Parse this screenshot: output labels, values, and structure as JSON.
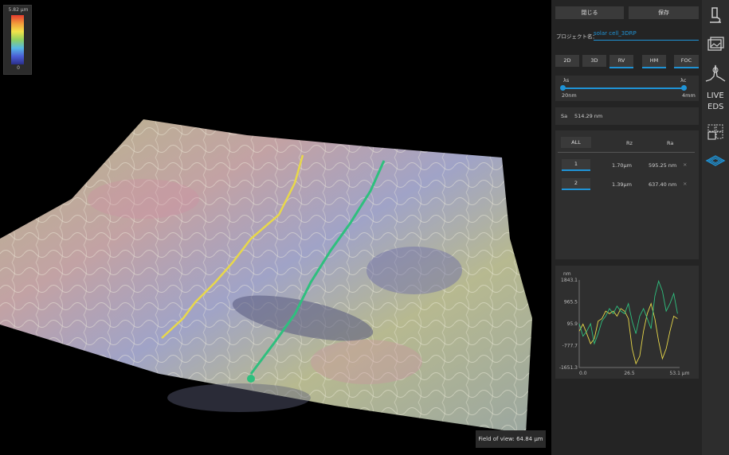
{
  "colorbar": {
    "max_label": "5.82 µm",
    "min_label": "0"
  },
  "field_of_view": "Field of view: 64.84 µm",
  "toolbar": {
    "close_label": "閉じる",
    "save_label": "保存"
  },
  "project": {
    "label": "プロジェクト名：",
    "value": "solar cell_3DRP"
  },
  "view_tabs": [
    "2D",
    "3D",
    "RV",
    "HM",
    "FOC"
  ],
  "filter": {
    "left_label": "λs",
    "right_label": "λc",
    "left_value": "20nm",
    "right_value": "4mm"
  },
  "sa": {
    "label": "Sa",
    "value": "514.29 nm"
  },
  "roughness_table": {
    "all_label": "ALL",
    "headers": [
      "Rz",
      "Ra"
    ],
    "rows": [
      {
        "id": "1",
        "rz": "1.70µm",
        "ra": "595.25 nm",
        "remove": "×"
      },
      {
        "id": "2",
        "rz": "1.39µm",
        "ra": "637.40 nm",
        "remove": "×"
      }
    ]
  },
  "chart_data": {
    "type": "line",
    "y_unit_label": "nm",
    "y_ticks": [
      "1843.1",
      "965.5",
      "95.9",
      "-777.7",
      "-1651.3"
    ],
    "x_ticks": [
      "0.0",
      "26.5",
      "53.1 µm"
    ],
    "xlim": [
      0,
      53.1
    ],
    "ylim": [
      -1651.3,
      1843.1
    ],
    "series": [
      {
        "color": "#e8d84a",
        "x": [
          0,
          2,
          4,
          6,
          8,
          10,
          12,
          14,
          16,
          18,
          20,
          22,
          24,
          26,
          28,
          30,
          32,
          34,
          36,
          38,
          40,
          42,
          44,
          46,
          48,
          50,
          52
        ],
        "values": [
          -200,
          80,
          -300,
          -700,
          -500,
          200,
          300,
          600,
          500,
          600,
          400,
          700,
          600,
          300,
          -900,
          -1500,
          -1200,
          -200,
          500,
          900,
          300,
          -600,
          -1300,
          -900,
          -200,
          400,
          300
        ]
      },
      {
        "color": "#2fbf7e",
        "x": [
          0,
          2,
          4,
          6,
          8,
          10,
          12,
          14,
          16,
          18,
          20,
          22,
          24,
          26,
          28,
          30,
          32,
          34,
          36,
          38,
          40,
          42,
          44,
          46,
          48,
          50,
          52
        ],
        "values": [
          100,
          -400,
          -200,
          100,
          -700,
          -300,
          200,
          400,
          700,
          500,
          800,
          600,
          500,
          900,
          200,
          -300,
          400,
          700,
          300,
          -100,
          1200,
          1800,
          1400,
          600,
          900,
          1300,
          500
        ]
      }
    ]
  },
  "rail": {
    "live_label": "LIVE",
    "eds_label": "EDS",
    "icons": [
      "microscope-icon",
      "image-icon",
      "spectrum-icon",
      "live-eds",
      "stitch-icon",
      "layers-3d-icon"
    ]
  }
}
